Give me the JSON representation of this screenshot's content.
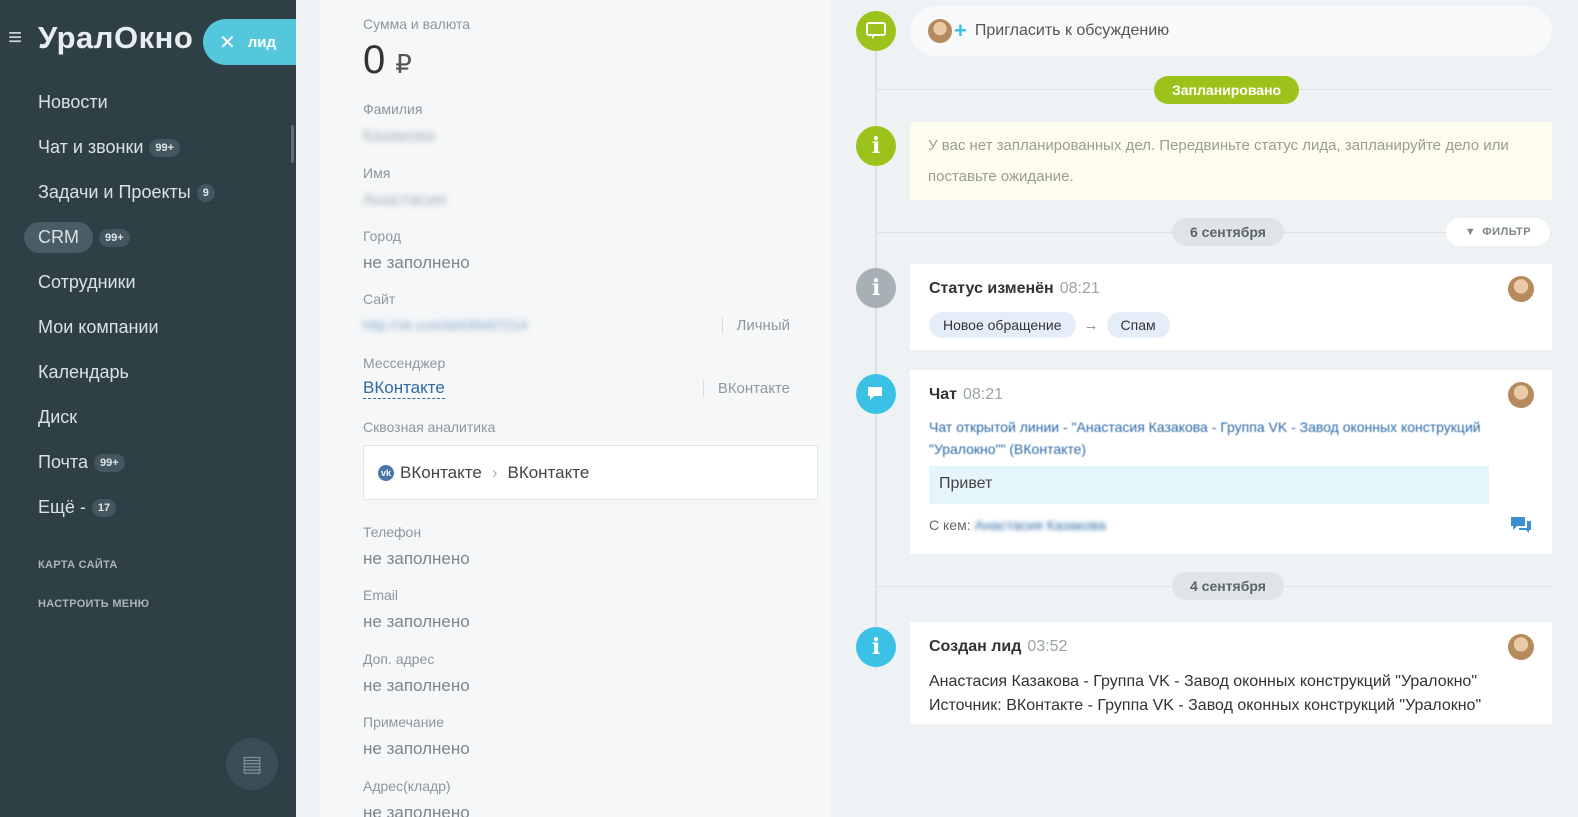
{
  "sidebar": {
    "logo": "УралОкно",
    "lead_tag": "лид",
    "items": [
      {
        "label": "Новости",
        "badge": ""
      },
      {
        "label": "Чат и звонки",
        "badge": "99+"
      },
      {
        "label": "Задачи и Проекты",
        "badge": "9"
      },
      {
        "label": "CRM",
        "badge": "99+"
      },
      {
        "label": "Сотрудники",
        "badge": ""
      },
      {
        "label": "Мои компании",
        "badge": ""
      },
      {
        "label": "Календарь",
        "badge": ""
      },
      {
        "label": "Диск",
        "badge": ""
      },
      {
        "label": "Почта",
        "badge": "99+"
      },
      {
        "label": "Ещё -",
        "badge": "17"
      }
    ],
    "sitemap": "КАРТА САЙТА",
    "configure_menu": "НАСТРОИТЬ МЕНЮ"
  },
  "details": {
    "amount_label": "Сумма и валюта",
    "amount_value": "0",
    "currency": "₽",
    "last_name_label": "Фамилия",
    "last_name_value": "Казакова",
    "first_name_label": "Имя",
    "first_name_value": "Анастасия",
    "city_label": "Город",
    "city_value": "не заполнено",
    "site_label": "Сайт",
    "site_value": "http://vk.com/id438497214",
    "site_type": "Личный",
    "messenger_label": "Мессенджер",
    "messenger_value": "ВКонтакте",
    "messenger_type": "ВКонтакте",
    "analytics_label": "Сквозная аналитика",
    "analytics_source": "ВКонтакте",
    "analytics_target": "ВКонтакте",
    "phone_label": "Телефон",
    "phone_value": "не заполнено",
    "email_label": "Email",
    "email_value": "не заполнено",
    "address_label": "Доп. адрес",
    "address_value": "не заполнено",
    "note_label": "Примечание",
    "note_value": "не заполнено",
    "kladr_label": "Адрес(кладр)",
    "kladr_value": "не заполнено"
  },
  "timeline": {
    "invite": "Пригласить к обсуждению",
    "planned": "Запланировано",
    "notice": "У вас нет запланированных дел. Передвиньте статус лида, запланируйте дело или поставьте ожидание.",
    "date1": "6 сентября",
    "filter": "ФИЛЬТР",
    "status_title": "Статус изменён",
    "status_time": "08:21",
    "status_from": "Новое обращение",
    "status_to": "Спам",
    "chat_title": "Чат",
    "chat_time": "08:21",
    "chat_link": "Чат открытой линии - \"Анастасия Казакова - Группа VK - Завод оконных конструкций \"Уралокно\"\" (ВКонтакте)",
    "chat_message": "Привет",
    "chat_with_label": "С кем:",
    "chat_with_value": "Анастасия Казакова",
    "date2": "4 сентября",
    "lead_title": "Создан лид",
    "lead_time": "03:52",
    "lead_line1": "Анастасия Казакова - Группа VK - Завод оконных конструкций \"Уралокно\"",
    "lead_line2": "Источник: ВКонтакте - Группа VK - Завод оконных конструкций \"Уралокно\""
  },
  "colors": {
    "sidebar_bg": "#2f3f46",
    "accent_cyan": "#55c7dc",
    "green": "#9cc31c",
    "link_blue": "#2d6ba7"
  }
}
